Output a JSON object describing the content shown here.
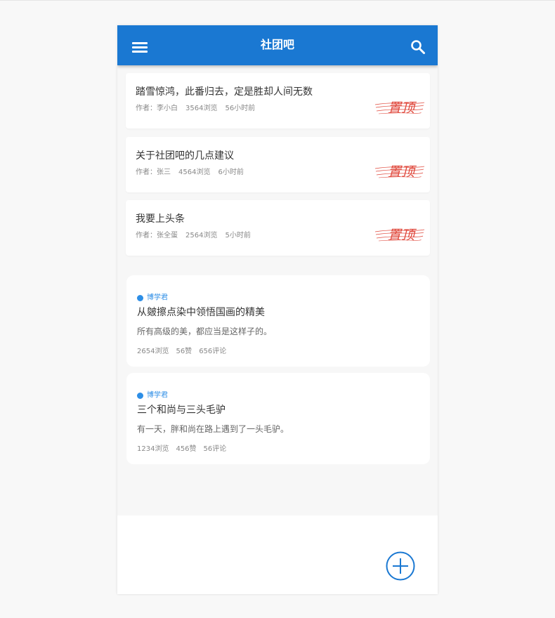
{
  "colors": {
    "header": "#1a78d2",
    "author_blue": "#2d8ee6",
    "stamp_red": "#e04a3e"
  },
  "header": {
    "title": "社团吧",
    "menu_icon": "hamburger-menu-icon",
    "search_icon": "search-icon"
  },
  "pinned_posts": [
    {
      "title": "踏雪惊鸿，此番归去，定是胜却人间无数",
      "author": "作者：李小白",
      "views": "3564浏览",
      "time": "56小时前"
    },
    {
      "title": "关于社团吧的几点建议",
      "author": "作者：张三",
      "views": "4564浏览",
      "time": "6小时前"
    },
    {
      "title": "我要上头条",
      "author": "作者：张全蛋",
      "views": "2564浏览",
      "time": "5小时前"
    }
  ],
  "articles": [
    {
      "author": "博学君",
      "title": "从皴擦点染中领悟国画的精美",
      "summary": "所有高级的美，都应当是这样子的。",
      "views": "2654浏览",
      "likes": "56赞",
      "comments": "656评论"
    },
    {
      "author": "博学君",
      "title": "三个和尚与三头毛驴",
      "summary": "有一天，胖和尚在路上遇到了一头毛驴。",
      "views": "1234浏览",
      "likes": "456赞",
      "comments": "56评论"
    }
  ],
  "stamp_text": "置顶",
  "fab_icon": "add-circle-icon"
}
